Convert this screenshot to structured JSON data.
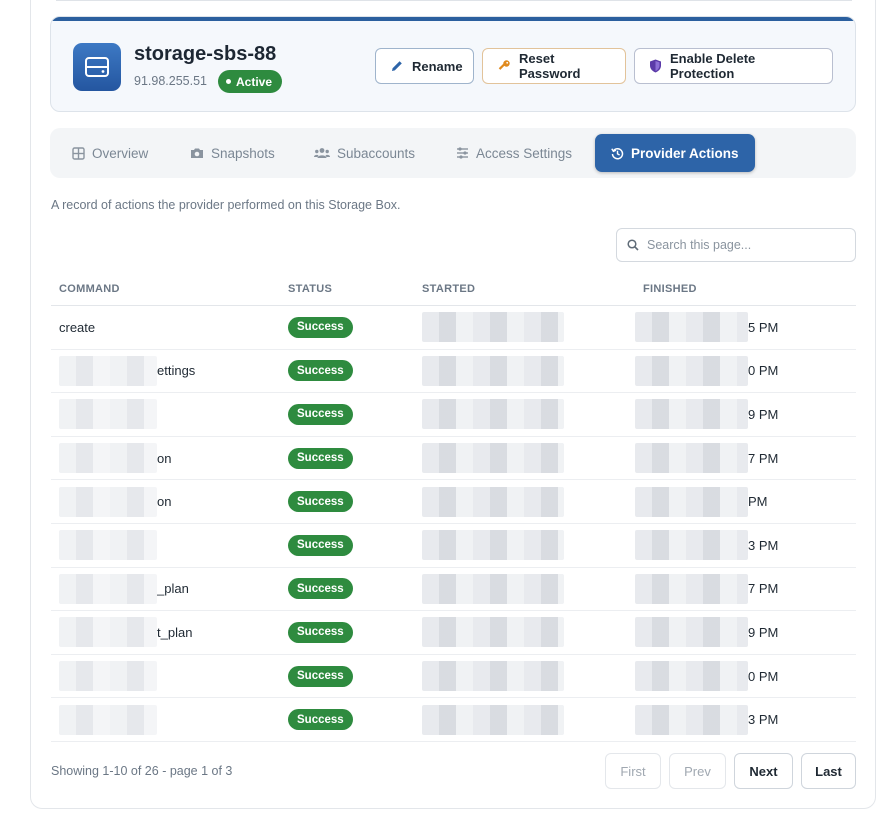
{
  "server": {
    "name": "storage-sbs-88",
    "ip": "91.98.255.51",
    "status": "Active"
  },
  "header_buttons": {
    "rename": "Rename",
    "reset_password": "Reset Password",
    "delete_protection": "Enable Delete Protection"
  },
  "tabs": [
    {
      "label": "Overview",
      "icon": "grid-icon"
    },
    {
      "label": "Snapshots",
      "icon": "camera-icon"
    },
    {
      "label": "Subaccounts",
      "icon": "users-icon"
    },
    {
      "label": "Access Settings",
      "icon": "sliders-icon"
    },
    {
      "label": "Provider Actions",
      "icon": "history-icon",
      "active": true
    }
  ],
  "description": "A record of actions the provider performed on this Storage Box.",
  "search": {
    "placeholder": "Search this page..."
  },
  "table": {
    "columns": [
      "COMMAND",
      "STATUS",
      "STARTED",
      "FINISHED"
    ],
    "rows": [
      {
        "command_visible": "create",
        "status": "Success",
        "finished_tail": "5 PM"
      },
      {
        "command_visible": "ettings",
        "status": "Success",
        "finished_tail": "0 PM"
      },
      {
        "command_visible": "",
        "status": "Success",
        "finished_tail": "9 PM"
      },
      {
        "command_visible": "on",
        "status": "Success",
        "finished_tail": "7 PM"
      },
      {
        "command_visible": "on",
        "status": "Success",
        "finished_tail": "PM"
      },
      {
        "command_visible": "",
        "status": "Success",
        "finished_tail": "3 PM"
      },
      {
        "command_visible": "_plan",
        "status": "Success",
        "finished_tail": "7 PM"
      },
      {
        "command_visible": "t_plan",
        "status": "Success",
        "finished_tail": "9 PM"
      },
      {
        "command_visible": "",
        "status": "Success",
        "finished_tail": "0 PM"
      },
      {
        "command_visible": "",
        "status": "Success",
        "finished_tail": "3 PM"
      }
    ]
  },
  "pagination": {
    "summary": "Showing 1-10 of 26 - page 1 of 3",
    "first": "First",
    "prev": "Prev",
    "next": "Next",
    "last": "Last"
  },
  "colors": {
    "primary": "#2d64a8",
    "success": "#2e8b3f"
  }
}
